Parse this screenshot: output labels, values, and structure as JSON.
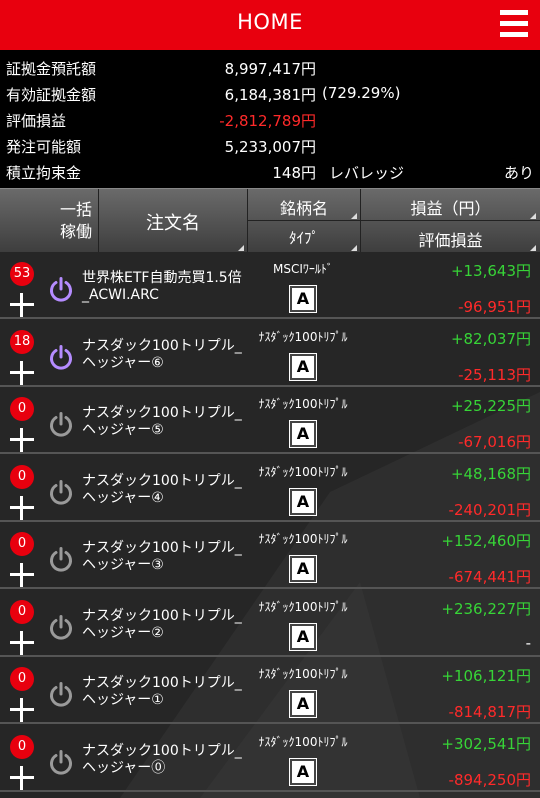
{
  "header": {
    "title": "HOME",
    "menu_icon": "hamburger-menu-icon"
  },
  "summary": {
    "rows": [
      {
        "label": "証拠金預託額",
        "value": "8,997,417円"
      },
      {
        "label": "有効証拠金額",
        "value": "6,184,381円",
        "extra": "(729.29%)"
      },
      {
        "label": "評価損益",
        "value": "-2,812,789円"
      },
      {
        "label": "発注可能額",
        "value": "5,233,007円"
      },
      {
        "label": "積立拘束金",
        "value": "148円"
      }
    ],
    "leverage_label": "レバレッジ",
    "leverage_value": "あり"
  },
  "table_header": {
    "bulk_line1": "一括",
    "bulk_line2": "稼働",
    "order_name": "注文名",
    "symbol_name": "銘柄名",
    "type": "ﾀｲﾌﾟ",
    "profit": "損益（円）",
    "eval_profit": "評価損益"
  },
  "colors": {
    "accent": "#e8000e",
    "positive": "#37d437",
    "negative": "#ff2a2a",
    "active_power": "#b58cff"
  },
  "orders": [
    {
      "count": "53",
      "active": true,
      "name": "世界株ETF自動売買1.5倍_ACWI.ARC",
      "symbol": "MSCIﾜｰﾙﾄﾞ",
      "type": "A",
      "profit": "+13,643円",
      "eval": "-96,951円"
    },
    {
      "count": "18",
      "active": true,
      "name": "ナスダック100トリプル_ヘッジャー⑥",
      "symbol": "ﾅｽﾀﾞｯｸ100ﾄﾘﾌﾟﾙ",
      "type": "A",
      "profit": "+82,037円",
      "eval": "-25,113円"
    },
    {
      "count": "0",
      "active": false,
      "name": "ナスダック100トリプル_ヘッジャー⑤",
      "symbol": "ﾅｽﾀﾞｯｸ100ﾄﾘﾌﾟﾙ",
      "type": "A",
      "profit": "+25,225円",
      "eval": "-67,016円"
    },
    {
      "count": "0",
      "active": false,
      "name": "ナスダック100トリプル_ヘッジャー④",
      "symbol": "ﾅｽﾀﾞｯｸ100ﾄﾘﾌﾟﾙ",
      "type": "A",
      "profit": "+48,168円",
      "eval": "-240,201円"
    },
    {
      "count": "0",
      "active": false,
      "name": "ナスダック100トリプル_ヘッジャー③",
      "symbol": "ﾅｽﾀﾞｯｸ100ﾄﾘﾌﾟﾙ",
      "type": "A",
      "profit": "+152,460円",
      "eval": "-674,441円"
    },
    {
      "count": "0",
      "active": false,
      "name": "ナスダック100トリプル_ヘッジャー②",
      "symbol": "ﾅｽﾀﾞｯｸ100ﾄﾘﾌﾟﾙ",
      "type": "A",
      "profit": "+236,227円",
      "eval": "-"
    },
    {
      "count": "0",
      "active": false,
      "name": "ナスダック100トリプル_ヘッジャー①",
      "symbol": "ﾅｽﾀﾞｯｸ100ﾄﾘﾌﾟﾙ",
      "type": "A",
      "profit": "+106,121円",
      "eval": "-814,817円"
    },
    {
      "count": "0",
      "active": false,
      "name": "ナスダック100トリプル_ヘッジャー⓪",
      "symbol": "ﾅｽﾀﾞｯｸ100ﾄﾘﾌﾟﾙ",
      "type": "A",
      "profit": "+302,541円",
      "eval": "-894,250円"
    }
  ]
}
